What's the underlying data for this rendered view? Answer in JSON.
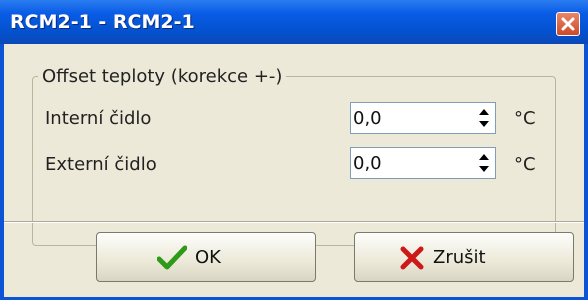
{
  "window": {
    "title": "RCM2-1 - RCM2-1"
  },
  "group": {
    "legend": "Offset teploty (korekce +-)",
    "rows": [
      {
        "label": "Interní čidlo",
        "value": "0,0",
        "unit": "°C"
      },
      {
        "label": "Externí čidlo",
        "value": "0,0",
        "unit": "°C"
      }
    ]
  },
  "buttons": {
    "ok_label": "OK",
    "cancel_label": "Zrušit"
  },
  "icons": {
    "ok": "checkmark-icon",
    "cancel": "x-icon",
    "close": "close-icon"
  },
  "colors": {
    "titlebar": "#0a5ce6",
    "dialog_bg": "#ece9d8",
    "ok_check": "#2e9a1a",
    "cancel_x": "#cc1a1a"
  }
}
